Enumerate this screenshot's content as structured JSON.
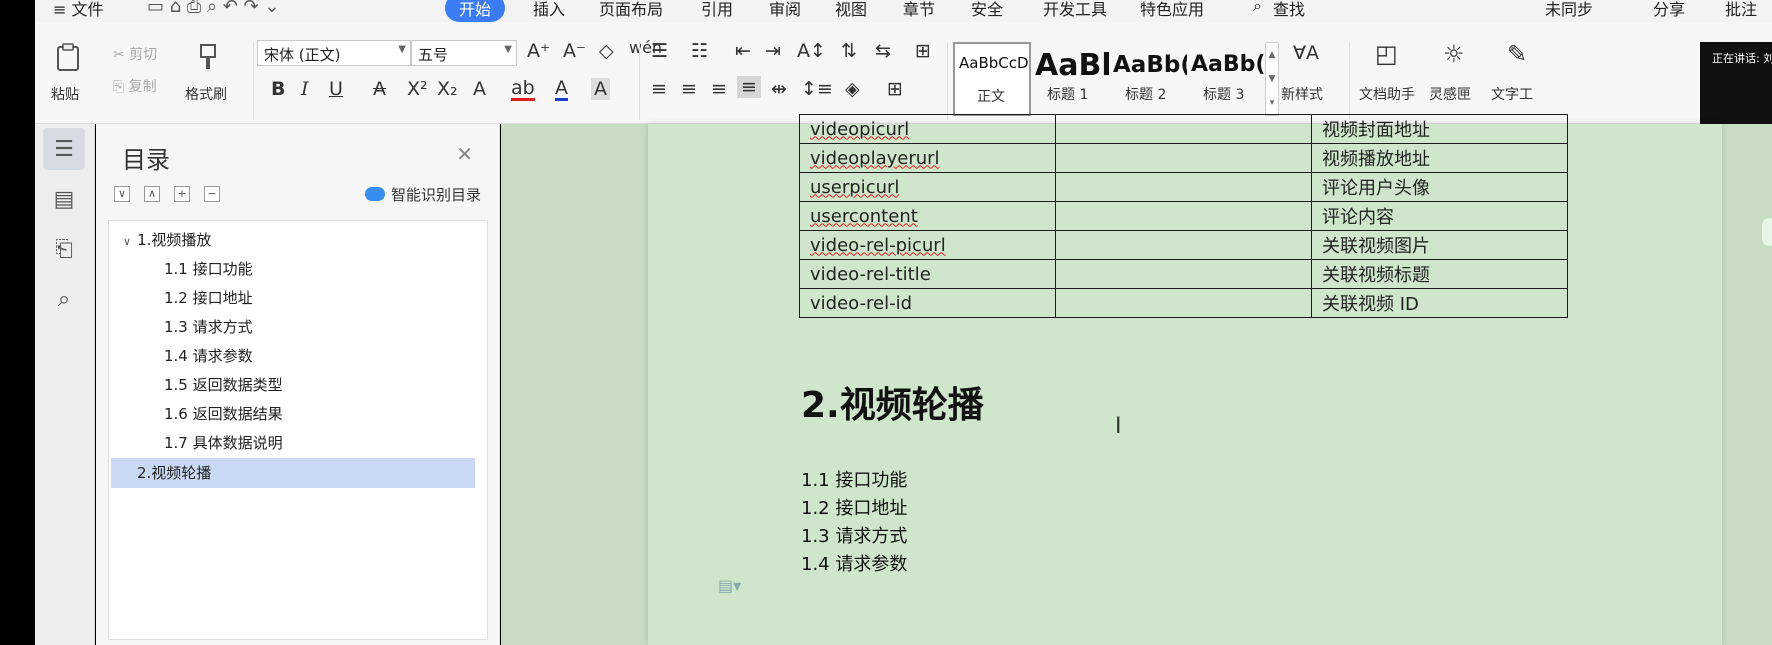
{
  "menubar": {
    "file": "≡ 文件",
    "tabs": [
      "开始",
      "插入",
      "页面布局",
      "引用",
      "审阅",
      "视图",
      "章节",
      "安全",
      "开发工具",
      "特色应用"
    ],
    "active_tab": "开始",
    "search": "查找",
    "sync": "未同步",
    "share": "分享",
    "comment": "批注"
  },
  "ribbon": {
    "paste": "粘贴",
    "cut": "剪切",
    "copy": "复制",
    "format_painter": "格式刷",
    "font_name": "宋体 (正文)",
    "font_size": "五号",
    "styles": [
      {
        "sample": "AaBbCcDd",
        "name": "正文"
      },
      {
        "sample": "AaBl",
        "name": "标题 1"
      },
      {
        "sample": "AaBb(",
        "name": "标题 2"
      },
      {
        "sample": "AaBb(",
        "name": "标题 3"
      }
    ],
    "new_style": "新样式",
    "doc_helper": "文档助手",
    "inspiration": "灵感匣",
    "text_tool": "文字工"
  },
  "speaking": {
    "label": "正在讲话: 刘",
    "name": "刘阳"
  },
  "toc": {
    "title": "目录",
    "ai_label": "智能识别目录",
    "items": [
      {
        "label": "1.视频播放",
        "level": 1,
        "expanded": true
      },
      {
        "label": "1.1  接口功能",
        "level": 2
      },
      {
        "label": "1.2  接口地址",
        "level": 2
      },
      {
        "label": "1.3  请求方式",
        "level": 2
      },
      {
        "label": "1.4  请求参数",
        "level": 2
      },
      {
        "label": "1.5  返回数据类型",
        "level": 2
      },
      {
        "label": "1.6  返回数据结果",
        "level": 2
      },
      {
        "label": "1.7  具体数据说明",
        "level": 2
      },
      {
        "label": "2.视频轮播",
        "level": 1,
        "selected": true
      }
    ]
  },
  "document": {
    "table_rows": [
      [
        "videopicurl",
        "",
        "视频封面地址"
      ],
      [
        "videoplayerurl",
        "",
        "视频播放地址"
      ],
      [
        "userpicurl",
        "",
        "评论用户头像"
      ],
      [
        "usercontent",
        "",
        "评论内容"
      ],
      [
        "video-rel-picurl",
        "",
        "关联视频图片"
      ],
      [
        "video-rel-title",
        "",
        "关联视频标题"
      ],
      [
        "video-rel-id",
        "",
        "关联视频 ID"
      ]
    ],
    "heading": "2.视频轮播",
    "subitems": [
      "1.1  接口功能",
      "1.2  接口地址",
      "1.3  请求方式",
      "1.4  请求参数"
    ]
  }
}
